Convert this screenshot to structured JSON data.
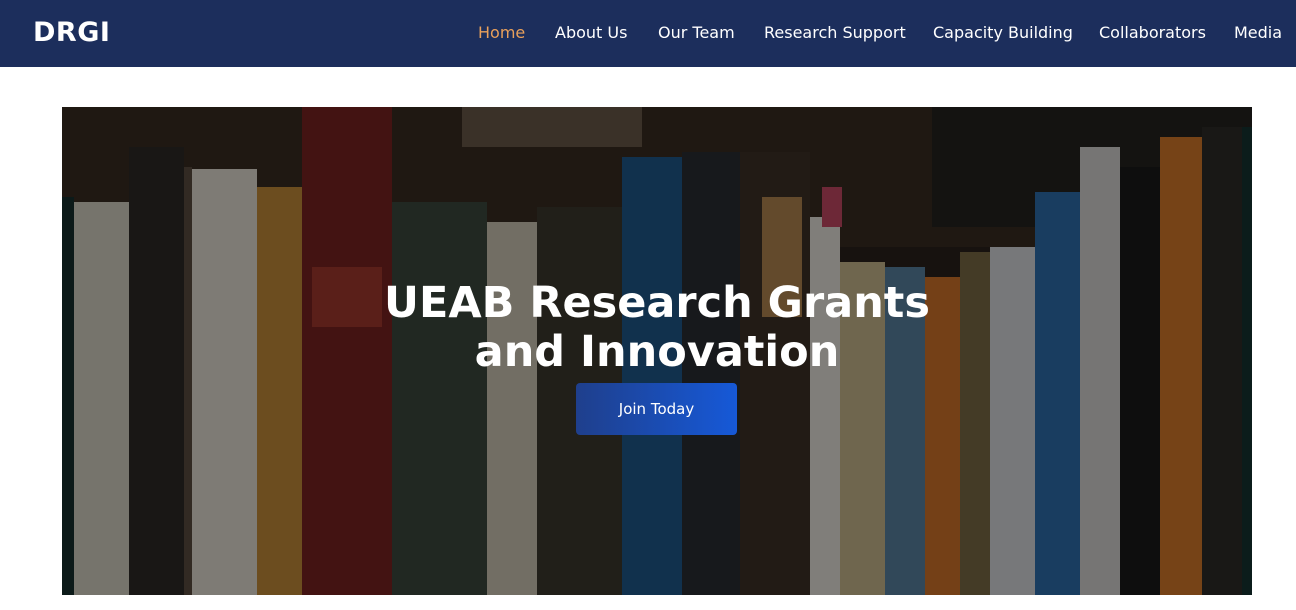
{
  "brand": "DRGI",
  "nav": {
    "items": [
      {
        "label": "Home",
        "active": true
      },
      {
        "label": "About Us"
      },
      {
        "label": "Our Team"
      },
      {
        "label": "Research Support"
      },
      {
        "label": "Capacity Building"
      },
      {
        "label": "Collaborators"
      },
      {
        "label": "Media"
      }
    ]
  },
  "hero": {
    "title_line1": "UEAB Research Grants",
    "title_line2": "and Innovation",
    "cta_label": "Join Today",
    "background": "bookshelf-photo"
  },
  "colors": {
    "navbar_bg": "#1c2e5c",
    "active_link": "#e9a05b",
    "cta_start": "#1f3f8c",
    "cta_end": "#1659d8"
  }
}
